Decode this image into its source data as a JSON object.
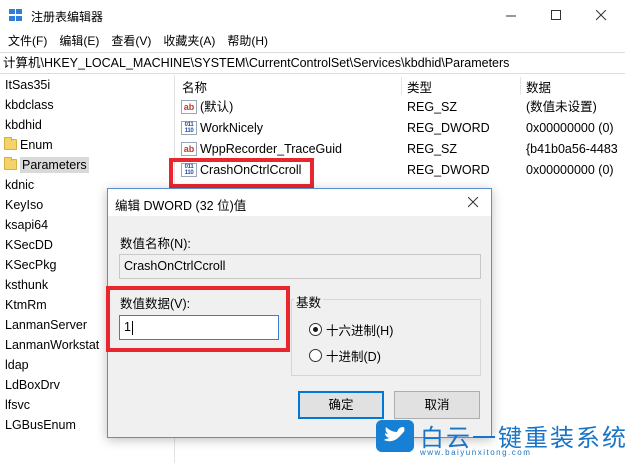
{
  "window": {
    "title": "注册表编辑器"
  },
  "menu": [
    "文件(F)",
    "编辑(E)",
    "查看(V)",
    "收藏夹(A)",
    "帮助(H)"
  ],
  "address": "计算机\\HKEY_LOCAL_MACHINE\\SYSTEM\\CurrentControlSet\\Services\\kbdhid\\Parameters",
  "tree": {
    "items": [
      {
        "label": "ItSas35i",
        "child": false
      },
      {
        "label": "kbdclass",
        "child": false
      },
      {
        "label": "kbdhid",
        "child": false
      },
      {
        "label": "Enum",
        "child": true
      },
      {
        "label": "Parameters",
        "child": true,
        "selected": true
      },
      {
        "label": "kdnic",
        "child": false
      },
      {
        "label": "KeyIso",
        "child": false
      },
      {
        "label": "ksapi64",
        "child": false
      },
      {
        "label": "KSecDD",
        "child": false
      },
      {
        "label": "KSecPkg",
        "child": false
      },
      {
        "label": "ksthunk",
        "child": false
      },
      {
        "label": "KtmRm",
        "child": false
      },
      {
        "label": "LanmanServer",
        "child": false
      },
      {
        "label": "LanmanWorkstat",
        "child": false
      },
      {
        "label": "ldap",
        "child": false
      },
      {
        "label": "LdBoxDrv",
        "child": false
      },
      {
        "label": "lfsvc",
        "child": false
      },
      {
        "label": "LGBusEnum",
        "child": false
      }
    ]
  },
  "list": {
    "headers": {
      "name": "名称",
      "type": "类型",
      "data": "数据"
    },
    "rows": [
      {
        "icon": "ab",
        "name": "(默认)",
        "type": "REG_SZ",
        "data": "(数值未设置)"
      },
      {
        "icon": "dword",
        "name": "WorkNicely",
        "type": "REG_DWORD",
        "data": "0x00000000 (0)"
      },
      {
        "icon": "ab",
        "name": "WppRecorder_TraceGuid",
        "type": "REG_SZ",
        "data": "{b41b0a56-4483"
      },
      {
        "icon": "dword",
        "name": "CrashOnCtrlCcroll",
        "type": "REG_DWORD",
        "data": "0x00000000 (0)"
      }
    ]
  },
  "dialog": {
    "title": "编辑 DWORD (32 位)值",
    "name_label": "数值名称(N):",
    "name_value": "CrashOnCtrlCcroll",
    "data_label": "数值数据(V):",
    "data_value": "1",
    "base_label": "基数",
    "hex_label": "十六进制(H)",
    "dec_label": "十进制(D)",
    "selected_base": "hex",
    "ok_label": "确定",
    "cancel_label": "取消"
  },
  "highlight_color": "#e8262e",
  "watermark": {
    "text": "白云一键重装系统",
    "url": "www.baiyunxitong.com"
  }
}
